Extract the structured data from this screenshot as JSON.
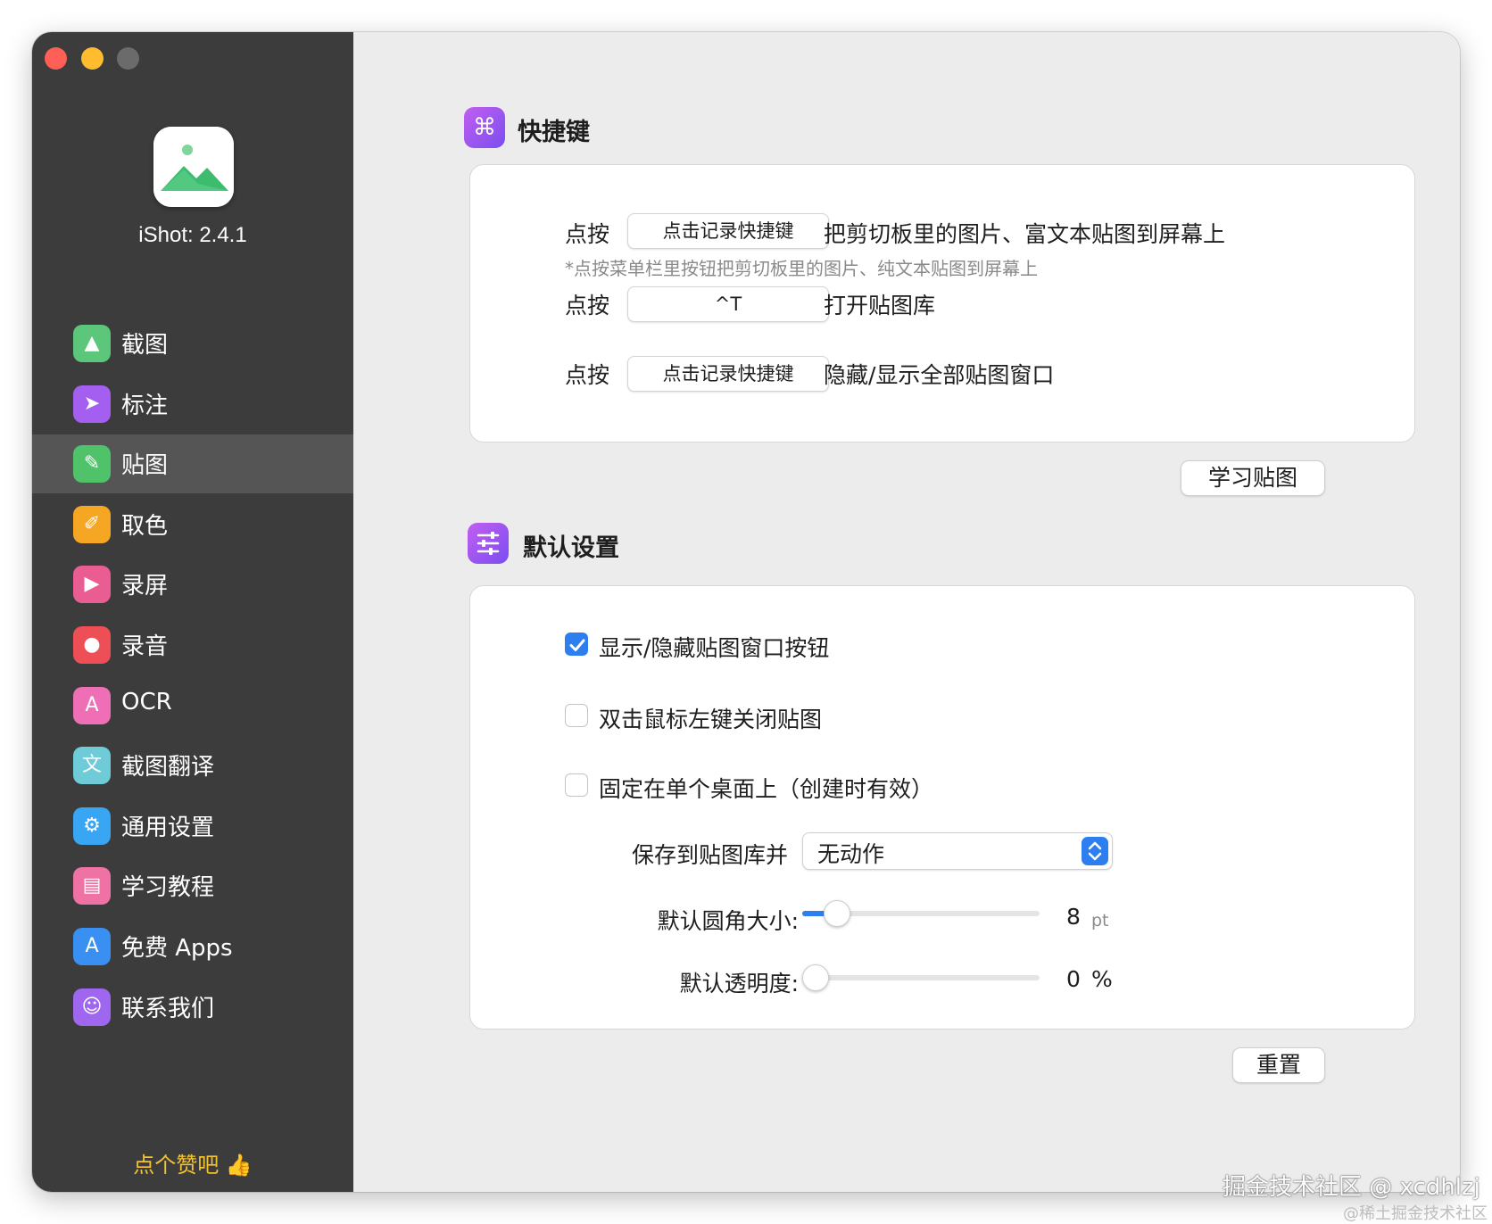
{
  "window": {
    "app_version": "iShot: 2.4.1"
  },
  "sidebar": {
    "items": [
      {
        "label": "截图",
        "icon": "image-icon",
        "color": "#5cc77a"
      },
      {
        "label": "标注",
        "icon": "cursor-icon",
        "color": "#a45ef0"
      },
      {
        "label": "贴图",
        "icon": "pin-icon",
        "color": "#4fc26a",
        "active": true
      },
      {
        "label": "取色",
        "icon": "eyedropper-icon",
        "color": "#f5a623"
      },
      {
        "label": "录屏",
        "icon": "video-icon",
        "color": "#e95d92"
      },
      {
        "label": "录音",
        "icon": "microphone-icon",
        "color": "#ee4f57"
      },
      {
        "label": "OCR",
        "icon": "ocr-icon",
        "color": "#ef6fb7"
      },
      {
        "label": "截图翻译",
        "icon": "translate-icon",
        "color": "#6fcbd8"
      },
      {
        "label": "通用设置",
        "icon": "gear-icon",
        "color": "#38a6f3"
      },
      {
        "label": "学习教程",
        "icon": "tutorial-icon",
        "color": "#ef72a5"
      },
      {
        "label": "免费 Apps",
        "icon": "app-store-icon",
        "color": "#3a8ff2"
      },
      {
        "label": "联系我们",
        "icon": "contacts-icon",
        "color": "#9f67f0"
      }
    ],
    "like_text": "点个赞吧 👍"
  },
  "shortcuts": {
    "title": "快捷键",
    "icon": "command-icon",
    "rows": [
      {
        "prefix": "点按",
        "key": "点击记录快捷键",
        "desc": "把剪切板里的图片、富文本贴图到屏幕上"
      },
      {
        "prefix": "点按",
        "key": "^T",
        "desc": "打开贴图库"
      },
      {
        "prefix": "点按",
        "key": "点击记录快捷键",
        "desc": "隐藏/显示全部贴图窗口"
      }
    ],
    "hint": "*点按菜单栏里按钮把剪切板里的图片、纯文本贴图到屏幕上",
    "learn_button": "学习贴图"
  },
  "defaults": {
    "title": "默认设置",
    "icon": "sliders-icon",
    "checkboxes": [
      {
        "label": "显示/隐藏贴图窗口按钮",
        "checked": true
      },
      {
        "label": "双击鼠标左键关闭贴图",
        "checked": false
      },
      {
        "label": "固定在单个桌面上（创建时有效）",
        "checked": false
      }
    ],
    "save_label": "保存到贴图库并",
    "save_value": "无动作",
    "radius_label": "默认圆角大小:",
    "radius_value": "8",
    "radius_unit": "pt",
    "radius_fraction": 0.1,
    "opacity_label": "默认透明度:",
    "opacity_value": "0",
    "opacity_unit": "%",
    "opacity_fraction": 0.0,
    "reset_button": "重置"
  },
  "watermark": {
    "line1": "掘金技术社区 @ xcdhlzj",
    "line2": "@稀土掘金技术社区"
  },
  "colors": {
    "accent": "#2d7ff0",
    "sidebar_bg": "#3c3c3c",
    "like": "#f4c430"
  }
}
